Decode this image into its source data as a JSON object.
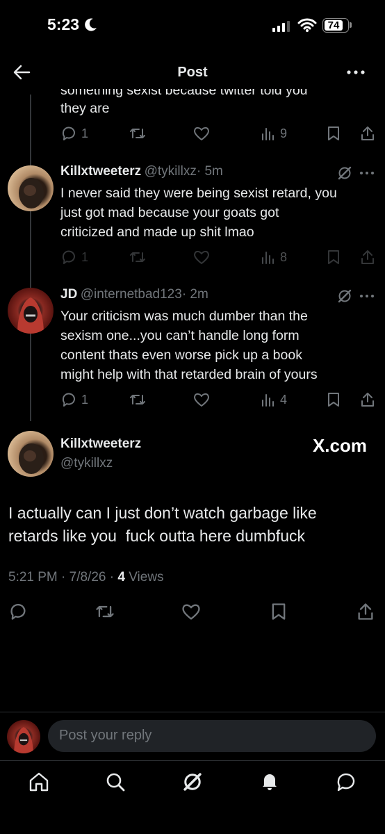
{
  "status_bar": {
    "time": "5:23",
    "battery": "74"
  },
  "header": {
    "title": "Post"
  },
  "top_tweet": {
    "partial_line": "something sexist because twitter told you",
    "last_line": "they are",
    "replies": "1",
    "views": "9"
  },
  "reply1": {
    "name": "Killxtweeterz",
    "handle": "@tykillxz",
    "time": "· 5m",
    "lines": [
      "I never said they were being sexist retard, you",
      "just got mad because your goats got",
      "criticized and made up shit lmao"
    ],
    "replies": "1",
    "views": "8"
  },
  "reply2": {
    "name": "JD",
    "handle": "@internetbad123",
    "time": "· 2m",
    "lines": [
      "Your criticism was much dumber than the",
      "sexism one...you can’t handle long form",
      "content thats even worse pick up a book",
      "might help with that retarded brain of yours"
    ],
    "replies": "1",
    "views": "4"
  },
  "main_tweet": {
    "name": "Killxtweeterz",
    "handle": "@tykillxz",
    "lines": [
      "I actually can I just don’t watch garbage like",
      "retards like you  fuck outta here dumbfuck"
    ],
    "timestamp": "5:21 PM · 7/8/26 · ",
    "views_count": "4",
    "views_label": " Views"
  },
  "watermark": "X.com",
  "reply_placeholder": "Post your reply",
  "icons": [
    "back-arrow-icon",
    "more-icon",
    "reply-icon",
    "repost-icon",
    "like-icon",
    "views-icon",
    "bookmark-icon",
    "share-icon",
    "grok-icon",
    "home-icon",
    "search-icon",
    "bell-icon",
    "messages-icon"
  ],
  "colors": {
    "background": "#000000",
    "text": "#e7e9ea",
    "secondary": "#71767b",
    "divider": "#2f3336"
  }
}
